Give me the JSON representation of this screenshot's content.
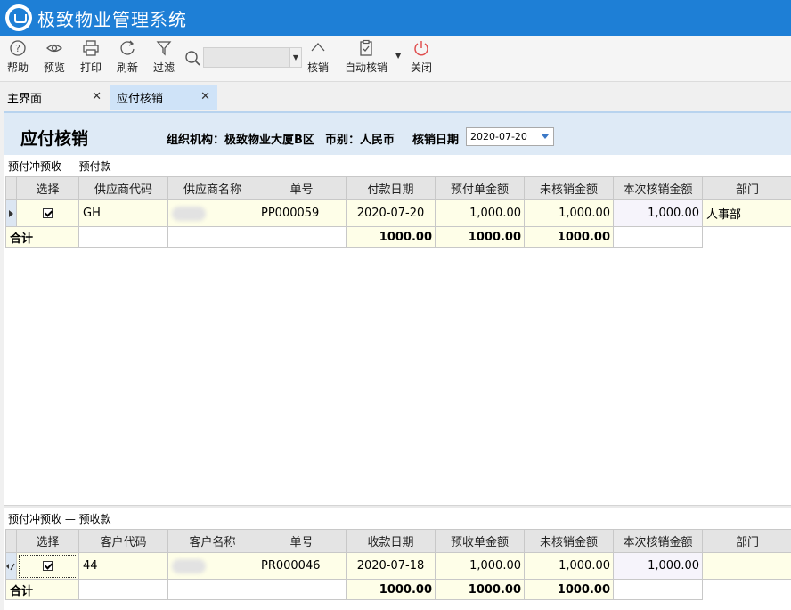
{
  "app": {
    "title": "极致物业管理系统"
  },
  "toolbar": {
    "help": "帮助",
    "preview": "预览",
    "print": "打印",
    "refresh": "刷新",
    "filter": "过滤",
    "search_value": "",
    "verify": "核销",
    "auto_verify": "自动核销",
    "close": "关闭"
  },
  "tabs": [
    {
      "label": "主界面"
    },
    {
      "label": "应付核销"
    }
  ],
  "header": {
    "title": "应付核销",
    "org": "组织机构：极致物业大厦B区",
    "currency": "币别：人民币",
    "date_label": "核销日期",
    "date_value": "2020-07-20"
  },
  "upper": {
    "section": "预付冲预收 — 预付款",
    "columns": [
      "选择",
      "供应商代码",
      "供应商名称",
      "单号",
      "付款日期",
      "预付单金额",
      "未核销金额",
      "本次核销金额",
      "部门"
    ],
    "rows": [
      {
        "code": "GH",
        "name": "",
        "no": "PP000059",
        "date": "2020-07-20",
        "amount": "1,000.00",
        "unverified": "1,000.00",
        "this_verify": "1,000.00",
        "dept": "人事部"
      }
    ],
    "total": {
      "label": "合计",
      "amount": "1000.00",
      "unverified": "1000.00",
      "this_verify": "1000.00"
    }
  },
  "lower": {
    "section": "预付冲预收 — 预收款",
    "columns": [
      "选择",
      "客户代码",
      "客户名称",
      "单号",
      "收款日期",
      "预收单金额",
      "未核销金额",
      "本次核销金额",
      "部门"
    ],
    "rows": [
      {
        "code": "44",
        "name": "",
        "no": "PR000046",
        "date": "2020-07-18",
        "amount": "1,000.00",
        "unverified": "1,000.00",
        "this_verify": "1,000.00",
        "dept": ""
      }
    ],
    "total": {
      "label": "合计",
      "amount": "1000.00",
      "unverified": "1000.00",
      "this_verify": "1000.00"
    }
  },
  "colors": {
    "titlebar": "#1e7fd6",
    "active_tab": "#cfe3f8",
    "header_panel": "#deeaf6",
    "close_icon": "#e05050"
  }
}
